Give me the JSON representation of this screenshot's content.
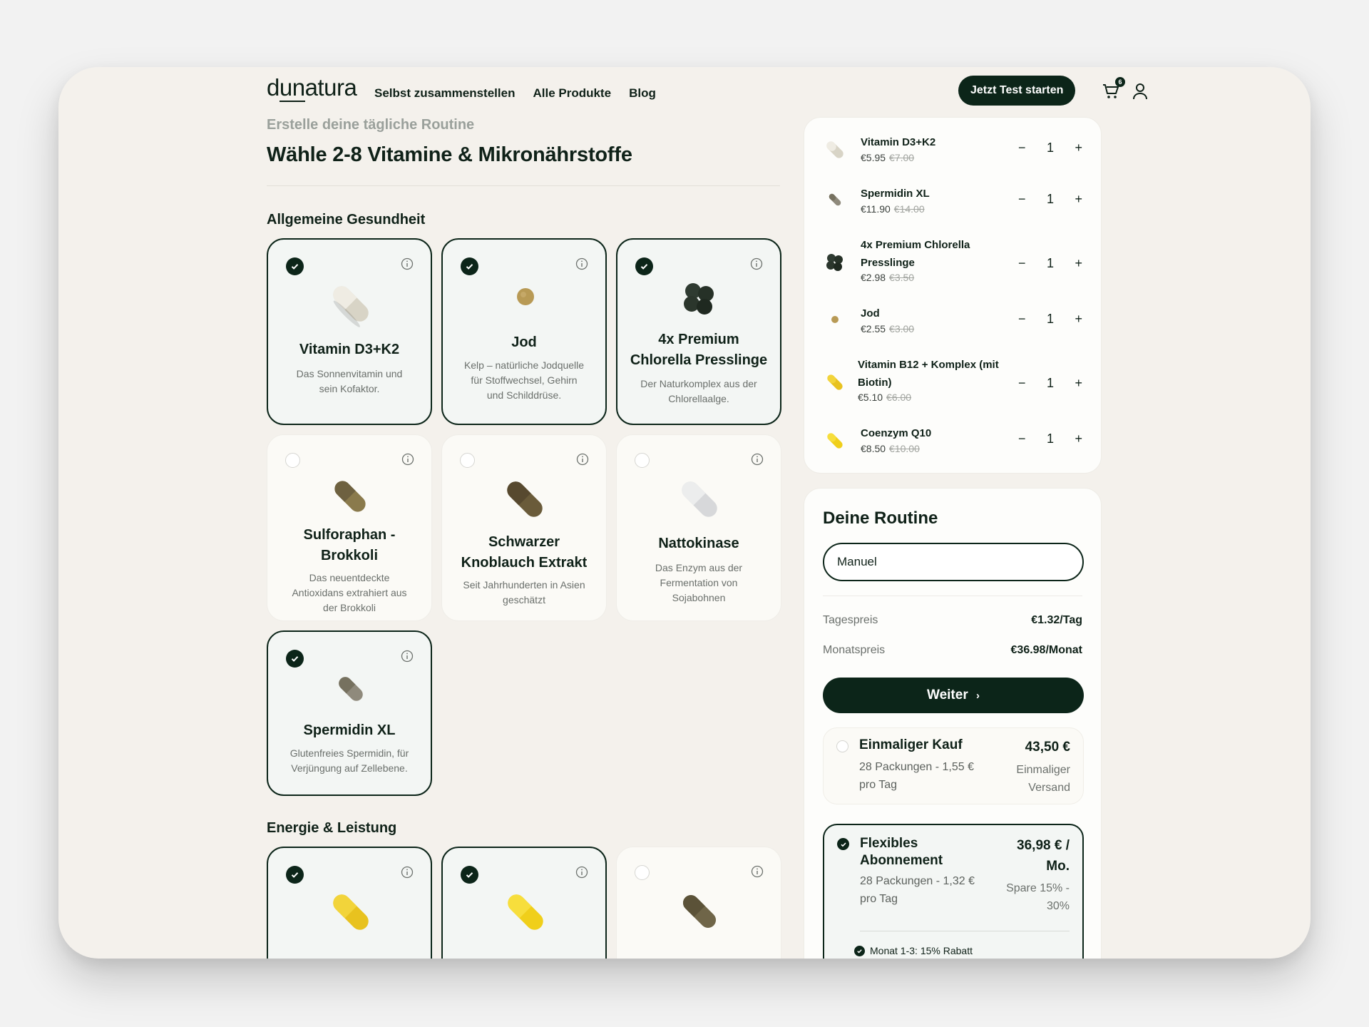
{
  "brand": {
    "logo_pre": "d",
    "logo_u": "un",
    "logo_post": "atura"
  },
  "nav": {
    "links": [
      "Selbst zusammenstellen",
      "Alle Produkte",
      "Blog"
    ],
    "cta": "Jetzt Test starten",
    "cart_count": "6"
  },
  "page": {
    "subtitle": "Erstelle deine tägliche Routine",
    "title": "Wähle 2-8 Vitamine & Mikronährstoffe"
  },
  "sections": [
    {
      "title": "Allgemeine Gesundheit",
      "cards": [
        {
          "title": "Vitamin D3+K2",
          "desc": "Das Sonnenvitamin und sein Kofaktor.",
          "selected": true
        },
        {
          "title": "Jod",
          "desc": "Kelp – natürliche Jodquelle für Stoffwechsel, Gehirn und Schilddrüse.",
          "selected": true
        },
        {
          "title_1": "4x Premium",
          "title_2": "Chlorella Presslinge",
          "desc": "Der Naturkomplex aus der Chlorellaalge.",
          "selected": true
        },
        {
          "title_1": "Sulforaphan -",
          "title_2": "Brokkoli",
          "desc": "Das neuentdeckte Antioxidans extrahiert aus der Brokkoli",
          "selected": false
        },
        {
          "title_1": "Schwarzer",
          "title_2": "Knoblauch Extrakt",
          "desc": "Seit Jahrhunderten in Asien geschätzt",
          "selected": false
        },
        {
          "title": "Nattokinase",
          "desc": "Das Enzym aus der Fermentation von Sojabohnen",
          "selected": false
        },
        {
          "title": "Spermidin XL",
          "desc": "Glutenfreies Spermidin, für Verjüngung auf Zellebene.",
          "selected": true
        }
      ]
    },
    {
      "title": "Energie & Leistung"
    }
  ],
  "cart_items": [
    {
      "name": "Vitamin D3+K2",
      "price": "€5.95",
      "old": "€7.00",
      "qty": "1"
    },
    {
      "name": "Spermidin XL",
      "price": "€11.90",
      "old": "€14.00",
      "qty": "1"
    },
    {
      "name_1": "4x Premium Chlorella",
      "name_2": "Presslinge",
      "price": "€2.98",
      "old": "€3.50",
      "qty": "1"
    },
    {
      "name": "Jod",
      "price": "€2.55",
      "old": "€3.00",
      "qty": "1"
    },
    {
      "name_1": "Vitamin B12 + Komplex (mit",
      "name_2": "Biotin)",
      "price": "€5.10",
      "old": "€6.00",
      "qty": "1"
    },
    {
      "name": "Coenzym Q10",
      "price": "€8.50",
      "old": "€10.00",
      "qty": "1"
    }
  ],
  "qty_minus": "−",
  "qty_plus": "+",
  "routine": {
    "title": "Deine Routine",
    "name_value": "Manuel",
    "daily_label": "Tagespreis",
    "daily_value": "€1.32/Tag",
    "monthly_label": "Monatspreis",
    "monthly_value": "€36.98/Monat",
    "button": "Weiter",
    "options": [
      {
        "title": "Einmaliger Kauf",
        "desc": "28 Packungen - 1,55 € pro Tag",
        "price": "43,50 €",
        "note": "Einmaliger Versand",
        "selected": false
      },
      {
        "title": "Flexibles Abonnement",
        "desc": "28 Packungen - 1,32 € pro Tag",
        "price": "36,98 € / Mo.",
        "note": "Spare 15% - 30%",
        "selected": true,
        "perk": "Monat 1-3: 15% Rabatt"
      }
    ]
  },
  "colors": {
    "primary": "#0c2519",
    "background": "#f4f1ec",
    "card": "#fbfaf6",
    "card_selected": "#f3f6f4"
  }
}
